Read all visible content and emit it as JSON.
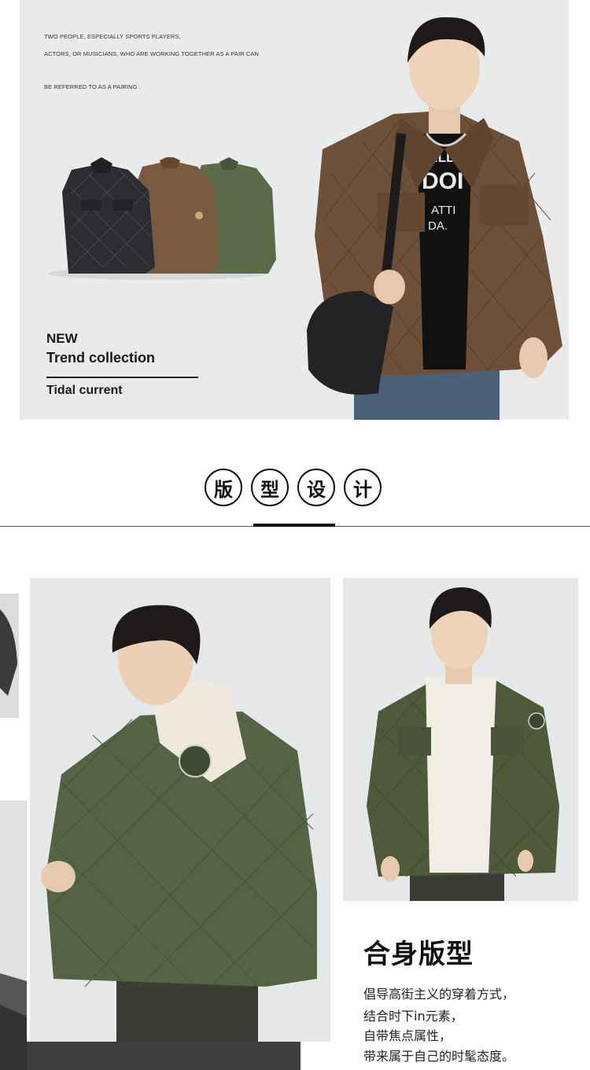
{
  "hero": {
    "copy_line_1": "TWO PEOPLE, ESPECIALLY SPORTS PLAYERS,",
    "copy_line_2": "ACTORS, OR MUSICIANS, WHO ARE WORKING TOGETHER AS A PAIR CAN",
    "copy_line_3": "BE REFERRED TO AS A PAIRING .",
    "new_label": "NEW",
    "trend_label": "Trend collection",
    "tidal_label": "Tidal current",
    "tshirt_text_1": "WILD O",
    "tshirt_text_2": "DOI",
    "tshirt_text_3": "ATTI",
    "tshirt_text_4": "DA."
  },
  "section": {
    "heading_chars": [
      "版",
      "型",
      "设",
      "计"
    ]
  },
  "fit": {
    "title": "合身版型",
    "lines": [
      "倡导高街主义的穿着方式，",
      "结合时下in元素，",
      "自带焦点属性，",
      "带来属于自己的时髦态度。"
    ]
  },
  "colors": {
    "brown_jacket": "#6e5038",
    "black_jacket": "#2b2d31",
    "green_jacket": "#566446",
    "olive_jacket": "#4e5a3a",
    "denim": "#4b6178",
    "photo_bg": "#e6e7e8"
  }
}
